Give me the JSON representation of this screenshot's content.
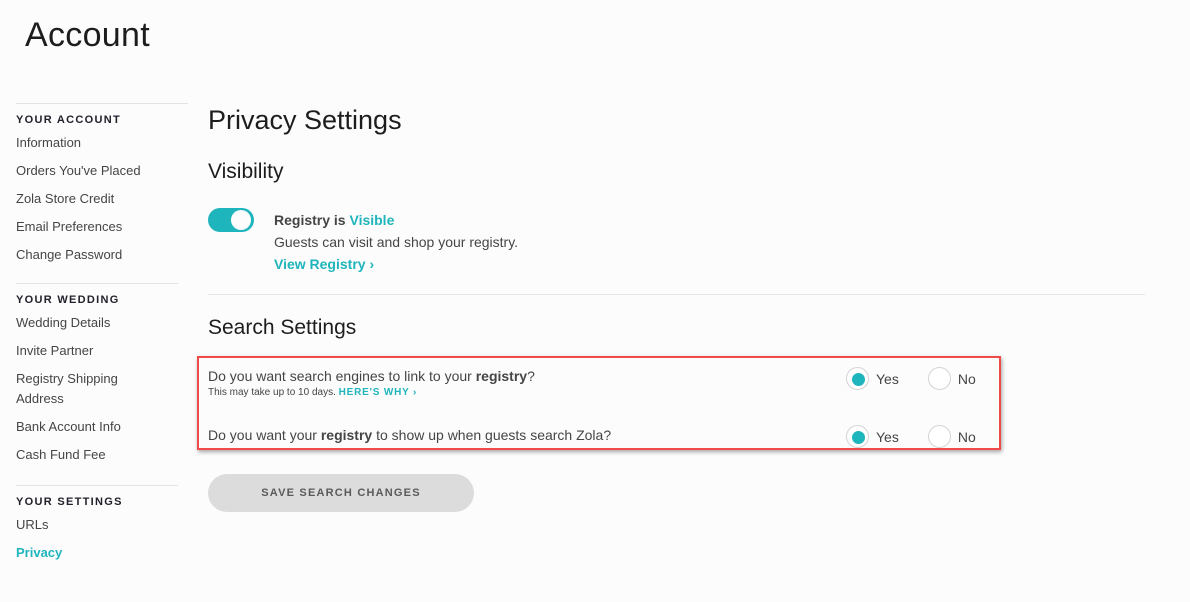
{
  "page": {
    "title": "Account"
  },
  "sidebar": {
    "groups": [
      {
        "heading": "YOUR ACCOUNT",
        "items": [
          "Information",
          "Orders You've Placed",
          "Zola Store Credit",
          "Email Preferences",
          "Change Password"
        ]
      },
      {
        "heading": "YOUR WEDDING",
        "items": [
          "Wedding Details",
          "Invite Partner",
          "Registry Shipping Address",
          "Bank Account Info",
          "Cash Fund Fee"
        ]
      },
      {
        "heading": "YOUR SETTINGS",
        "items": [
          "URLs",
          "Privacy"
        ]
      }
    ],
    "active_item": "Privacy"
  },
  "main": {
    "title": "Privacy Settings",
    "visibility": {
      "heading": "Visibility",
      "toggle_on": true,
      "status_prefix": "Registry is ",
      "status_value": "Visible",
      "description": "Guests can visit and shop your registry.",
      "link_label": "View Registry ›"
    },
    "search": {
      "heading": "Search Settings",
      "questions": [
        {
          "pre": "Do you want search engines to link to your ",
          "bold": "registry",
          "post": "?",
          "note": "This may take up to 10 days. ",
          "note_link": "HERE'S WHY ›",
          "yes_label": "Yes",
          "no_label": "No",
          "selected": "Yes"
        },
        {
          "pre": "Do you want your ",
          "bold": "registry",
          "post": " to show up when guests search Zola?",
          "yes_label": "Yes",
          "no_label": "No",
          "selected": "Yes"
        }
      ],
      "save_label": "SAVE SEARCH CHANGES"
    }
  },
  "colors": {
    "accent": "#1fb5bc",
    "highlight_border": "#f04a4a",
    "button_bg": "#dcdcdc"
  }
}
